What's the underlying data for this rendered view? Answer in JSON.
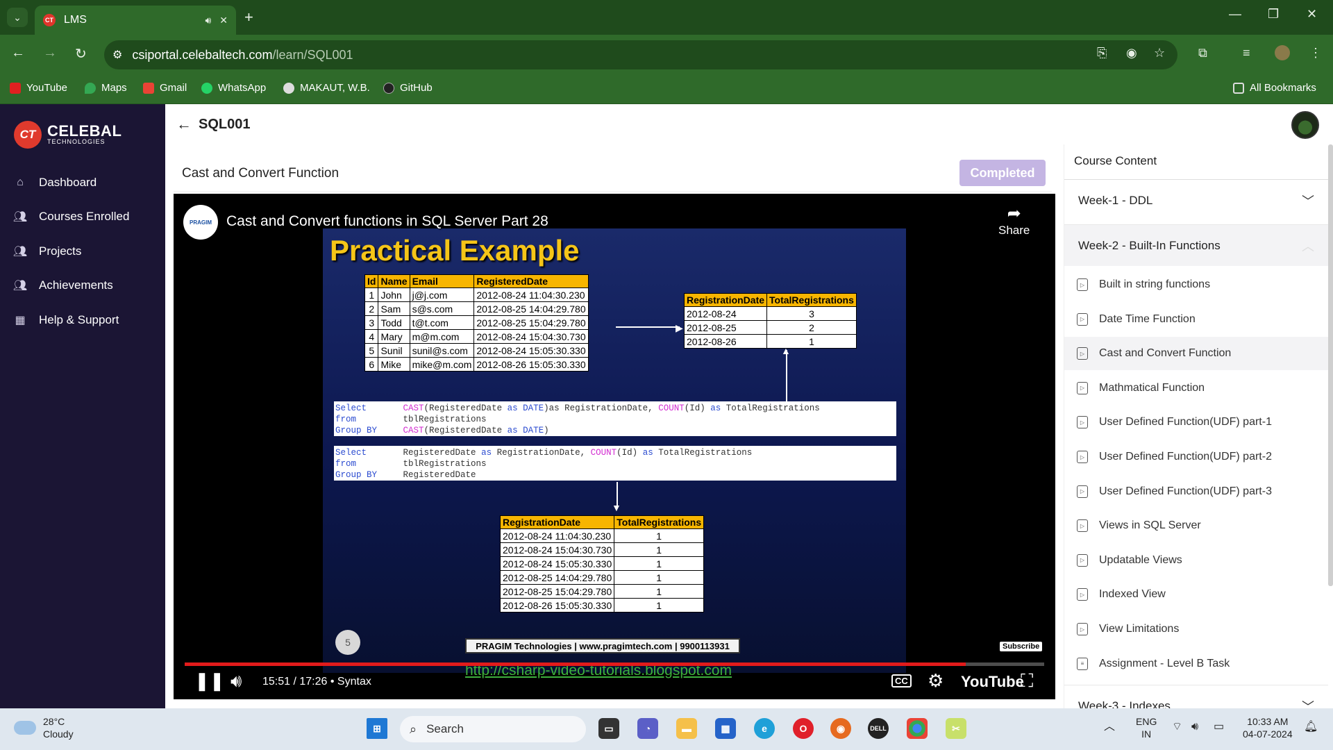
{
  "browser": {
    "tab_title": "LMS",
    "url_host": "csiportal.celebaltech.com",
    "url_path": "/learn/SQL001",
    "bookmarks": [
      "YouTube",
      "Maps",
      "Gmail",
      "WhatsApp",
      "MAKAUT, W.B.",
      "GitHub"
    ],
    "all_bookmarks": "All Bookmarks"
  },
  "sidebar": {
    "brand": "CELEBAL",
    "brand_sub": "TECHNOLOGIES",
    "items": [
      {
        "label": "Dashboard",
        "icon": "home-icon"
      },
      {
        "label": "Courses Enrolled",
        "icon": "people-icon"
      },
      {
        "label": "Projects",
        "icon": "people-icon"
      },
      {
        "label": "Achievements",
        "icon": "people-icon"
      },
      {
        "label": "Help & Support",
        "icon": "calendar-icon"
      }
    ]
  },
  "header": {
    "course_code": "SQL001"
  },
  "lesson": {
    "title": "Cast and Convert Function",
    "status_button": "Completed"
  },
  "video": {
    "title": "Cast and Convert functions in SQL Server Part 28",
    "share": "Share",
    "time": "15:51 / 17:26",
    "chapter": "Syntax",
    "progress": 0.909,
    "subscribe": "Subscribe",
    "slide": {
      "heading": "Practical Example",
      "table1": {
        "headers": [
          "Id",
          "Name",
          "Email",
          "RegisteredDate"
        ],
        "rows": [
          [
            "1",
            "John",
            "j@j.com",
            "2012-08-24 11:04:30.230"
          ],
          [
            "2",
            "Sam",
            "s@s.com",
            "2012-08-25 14:04:29.780"
          ],
          [
            "3",
            "Todd",
            "t@t.com",
            "2012-08-25 15:04:29.780"
          ],
          [
            "4",
            "Mary",
            "m@m.com",
            "2012-08-24 15:04:30.730"
          ],
          [
            "5",
            "Sunil",
            "sunil@s.com",
            "2012-08-24 15:05:30.330"
          ],
          [
            "6",
            "Mike",
            "mike@m.com",
            "2012-08-26 15:05:30.330"
          ]
        ]
      },
      "table2": {
        "headers": [
          "RegistrationDate",
          "TotalRegistrations"
        ],
        "rows": [
          [
            "2012-08-24",
            "3"
          ],
          [
            "2012-08-25",
            "2"
          ],
          [
            "2012-08-26",
            "1"
          ]
        ]
      },
      "table3": {
        "headers": [
          "RegistrationDate",
          "TotalRegistrations"
        ],
        "rows": [
          [
            "2012-08-24 11:04:30.230",
            "1"
          ],
          [
            "2012-08-24 15:04:30.730",
            "1"
          ],
          [
            "2012-08-24 15:05:30.330",
            "1"
          ],
          [
            "2012-08-25 14:04:29.780",
            "1"
          ],
          [
            "2012-08-25 15:04:29.780",
            "1"
          ],
          [
            "2012-08-26 15:05:30.330",
            "1"
          ]
        ]
      },
      "sql1": [
        "Select",
        "CAST",
        "(RegisteredDate",
        "as",
        "DATE",
        ")as RegistrationDate,",
        "COUNT",
        "(Id)",
        "as",
        "TotalRegistrations",
        "from",
        "tblRegistrations",
        "Group BY",
        "CAST",
        "(RegisteredDate",
        "as",
        "DATE",
        ")"
      ],
      "sql2": [
        "Select",
        "RegisteredDate",
        "as",
        "RegistrationDate,",
        "COUNT",
        "(Id)",
        "as",
        "TotalRegistrations",
        "from",
        "tblRegistrations",
        "Group BY",
        "RegisteredDate"
      ],
      "footer": "PRAGIM Technologies | www.pragimtech.com | 9900113931",
      "blog": "http://csharp-video-tutorials.blogspot.com",
      "slide_number": "5"
    }
  },
  "course_content": {
    "title": "Course Content",
    "weeks": [
      {
        "label": "Week-1 - DDL"
      },
      {
        "label": "Week-2 - Built-In Functions"
      },
      {
        "label": "Week-3 - Indexes"
      }
    ],
    "lessons": [
      "Built in string functions",
      "Date Time Function",
      "Cast and Convert Function",
      "Mathmatical Function",
      "User Defined Function(UDF) part-1",
      "User Defined Function(UDF) part-2",
      "User Defined Function(UDF) part-3",
      "Views in SQL Server",
      "Updatable Views",
      "Indexed View",
      "View Limitations",
      "Assignment - Level B Task"
    ]
  },
  "taskbar": {
    "temp": "28°C",
    "condition": "Cloudy",
    "search": "Search",
    "lang1": "ENG",
    "lang2": "IN",
    "time": "10:33 AM",
    "date": "04-07-2024"
  }
}
